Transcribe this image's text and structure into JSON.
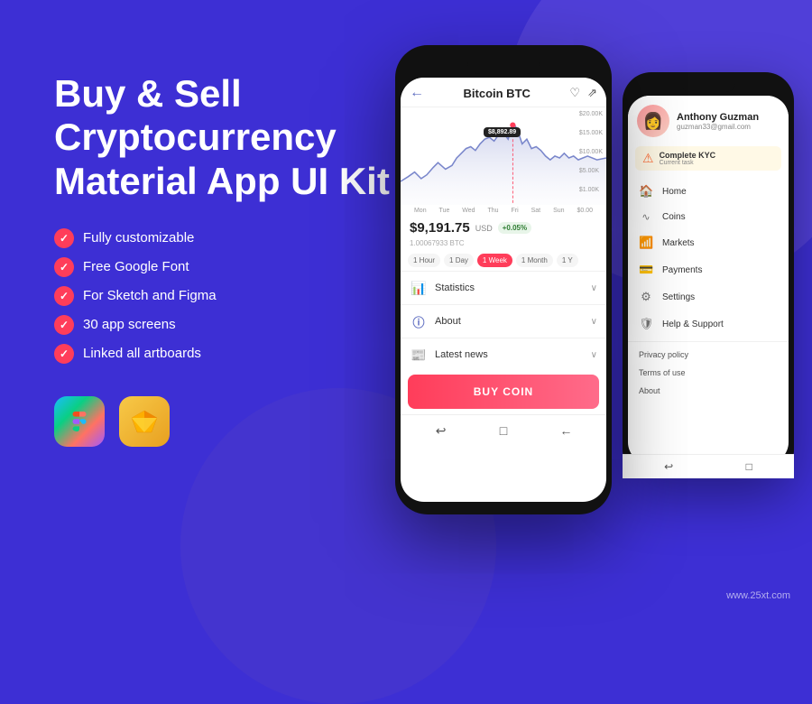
{
  "background": {
    "color": "#3d2fd4"
  },
  "left": {
    "title": "Buy & Sell\nCryptocurrency\nMaterial App UI Kit",
    "features": [
      "Fully customizable",
      "Free Google Font",
      "For Sketch and Figma",
      "30 app screens",
      "Linked all artboards"
    ],
    "tools": [
      {
        "name": "Figma",
        "symbol": "◈"
      },
      {
        "name": "Sketch",
        "symbol": "◇"
      }
    ]
  },
  "phone_main": {
    "header": {
      "back": "←",
      "title": "Bitcoin BTC",
      "heart": "♡",
      "share": "⟨⟩"
    },
    "chart": {
      "y_labels": [
        "$20.00K",
        "$15.00K",
        "$10.00K",
        "$5.00K",
        "$1.00K"
      ],
      "x_labels": [
        "Mon",
        "Tue",
        "Wed",
        "Thu",
        "Fri",
        "Sat",
        "Sun",
        "$0.00"
      ],
      "tooltip": "$8,892.89"
    },
    "price": {
      "amount": "$9,191.75",
      "unit": "USD",
      "change": "+0.05%",
      "btc": "1.00067933 BTC"
    },
    "time_tabs": [
      {
        "label": "1 Hour",
        "active": false
      },
      {
        "label": "1 Day",
        "active": false
      },
      {
        "label": "1 Week",
        "active": true
      },
      {
        "label": "1 Month",
        "active": false
      },
      {
        "label": "1 Y",
        "active": false
      }
    ],
    "accordion": [
      {
        "icon": "📊",
        "label": "Statistics"
      },
      {
        "icon": "ℹ",
        "label": "About"
      },
      {
        "icon": "📰",
        "label": "Latest news"
      }
    ],
    "buy_button": "BUY COIN",
    "nav": [
      "↩",
      "□",
      "←"
    ]
  },
  "phone_secondary": {
    "user": {
      "avatar_emoji": "👩",
      "name": "Anthony Guzman",
      "email": "guzman33@gmail.com"
    },
    "kyc": {
      "icon": "⚠",
      "title": "Complete KYC",
      "subtitle": "Current task"
    },
    "menu": [
      {
        "icon": "🏠",
        "label": "Home"
      },
      {
        "icon": "≈",
        "label": "Coins"
      },
      {
        "icon": "📊",
        "label": "Markets"
      },
      {
        "icon": "💳",
        "label": "Payments"
      },
      {
        "icon": "⚙",
        "label": "Settings"
      },
      {
        "icon": "🛡",
        "label": "Help & Support"
      }
    ],
    "links": [
      "Privacy policy",
      "Terms of use",
      "About"
    ],
    "nav": [
      "↩",
      "□"
    ]
  },
  "watermark": "www.25xt.com"
}
